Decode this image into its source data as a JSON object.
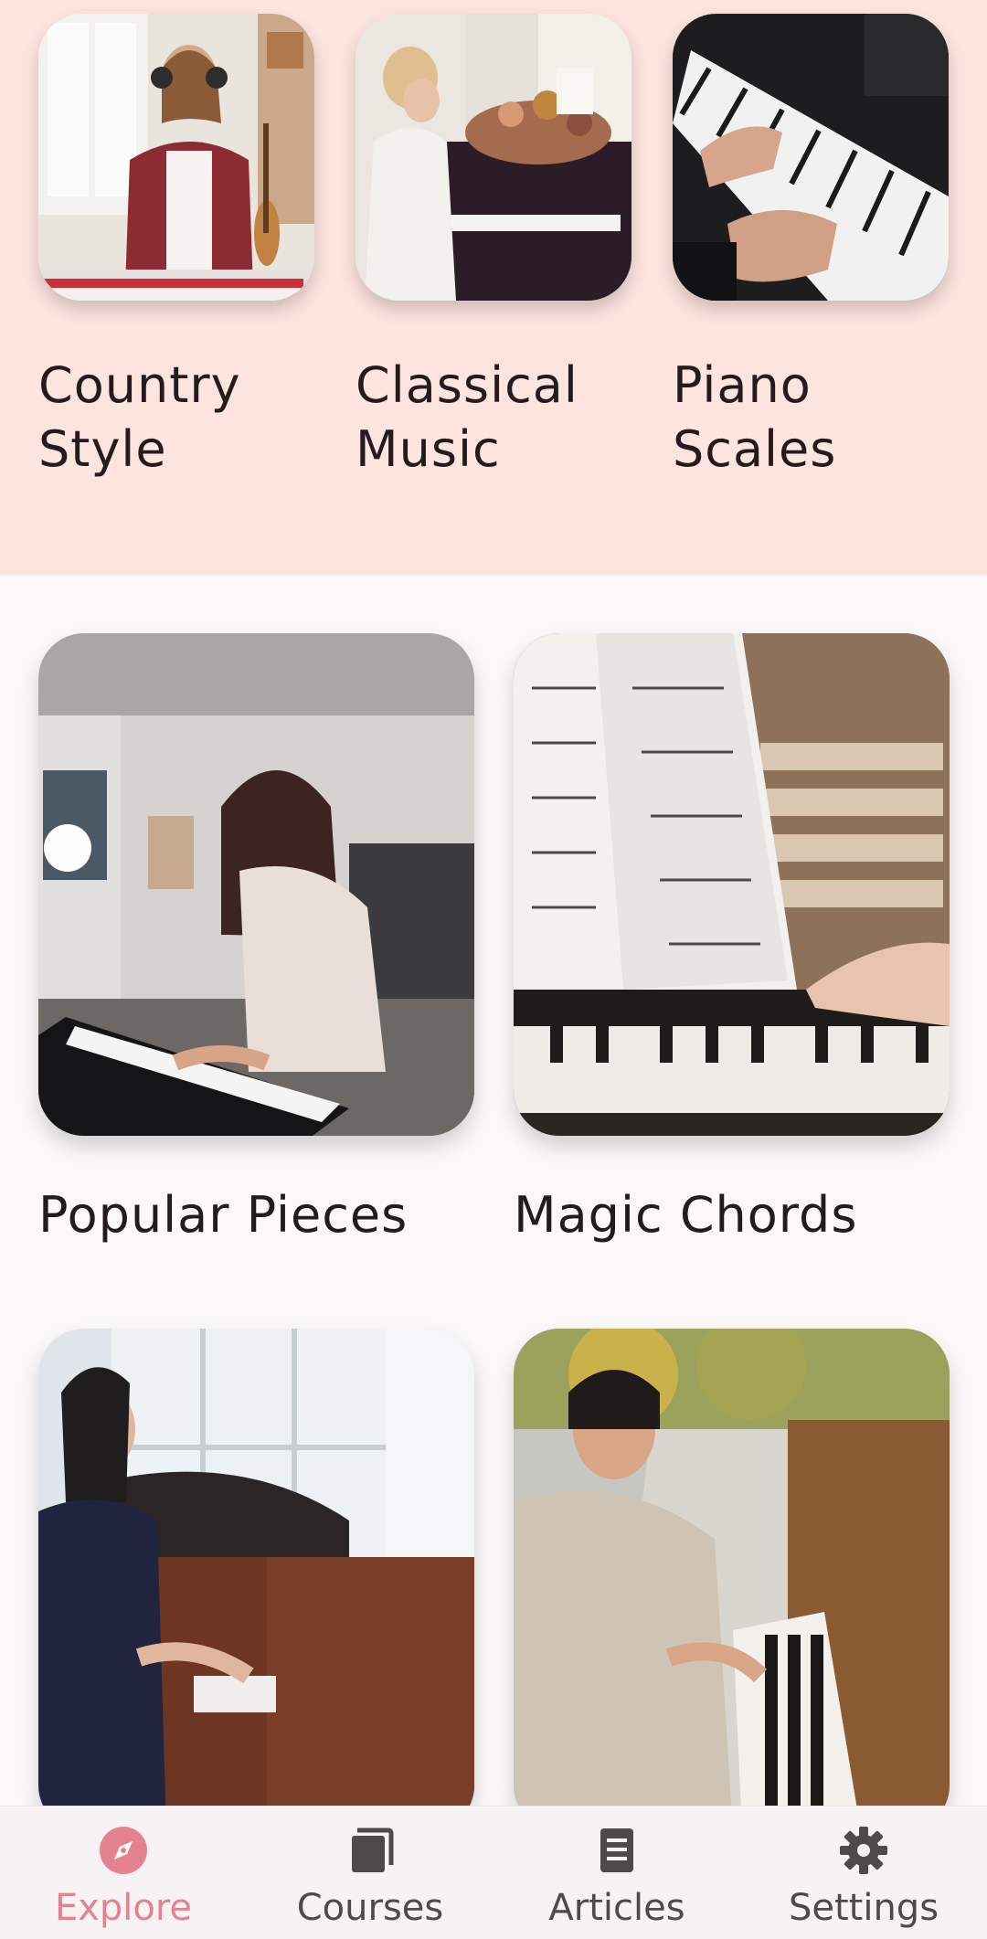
{
  "featured": [
    {
      "title": "Country Style",
      "image": "woman-headphones-keyboard-photo"
    },
    {
      "title": "Classical Music",
      "image": "woman-grand-piano-photo"
    },
    {
      "title": "Piano Scales",
      "image": "hands-on-keys-photo"
    }
  ],
  "courses": [
    {
      "title": "Popular Pieces",
      "image": "woman-playing-piano-photo"
    },
    {
      "title": "Magic Chords",
      "image": "sheet-music-piano-photo"
    },
    {
      "title": "",
      "image": "woman-grand-piano-window-photo"
    },
    {
      "title": "",
      "image": "woman-upright-piano-outdoor-photo"
    }
  ],
  "nav": {
    "items": [
      {
        "label": "Explore",
        "icon": "compass-icon",
        "active": true
      },
      {
        "label": "Courses",
        "icon": "stack-icon",
        "active": false
      },
      {
        "label": "Articles",
        "icon": "article-icon",
        "active": false
      },
      {
        "label": "Settings",
        "icon": "gear-icon",
        "active": false
      }
    ]
  },
  "colors": {
    "top_background": "#fde4df",
    "page_background": "#fbf8f9",
    "accent": "#e4828f",
    "nav_background": "#f7f3f5"
  }
}
